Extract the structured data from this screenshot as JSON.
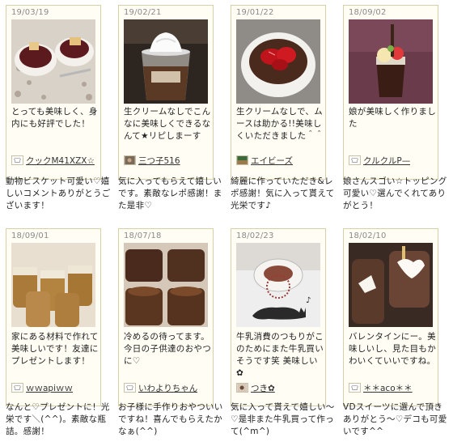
{
  "cards": [
    {
      "date": "19/03/19",
      "comment": "とっても美味しく、身内にも好評でした！",
      "user": "クックM41XZX☆",
      "avatar_icon": "chef-hat-icon",
      "reply": "動物ビスケット可愛い♡嬉しいコメントありがとうございます！"
    },
    {
      "date": "19/02/21",
      "comment": "生クリームなしでこんなに美味しくできるなんて★リピしまーす",
      "user": "三つ子516",
      "avatar_icon": "photo-avatar-icon",
      "reply": "気に入ってもらえて嬉しいです。素敵なレポ感謝！また是非♡"
    },
    {
      "date": "19/01/22",
      "comment": "生クリームなしで、ムースは助かる!!美味しくいただきました＾＾",
      "user": "エイビーズ",
      "avatar_icon": "photo-avatar-icon",
      "reply": "綺麗に作っていただき&レポ感謝！気に入って貰えて光栄です♪"
    },
    {
      "date": "18/09/02",
      "comment": "娘が美味しく作りました",
      "user": "クルクルP—",
      "avatar_icon": "chef-hat-icon",
      "reply": "娘さんスゴい☆トッピング可愛い♡選んでくれてありがとう！"
    },
    {
      "date": "18/09/01",
      "comment": "家にある材料で作れて美味しいです！友達にプレゼントします！",
      "user": "ｗｗapiｗｗ",
      "avatar_icon": "chef-hat-icon",
      "reply": "なんと♡プレゼントに！光栄です＼(^^)。素敵な瓶詰。感謝！"
    },
    {
      "date": "18/07/18",
      "comment": "冷めるの待ってます。今日の子供達のおやつに♡",
      "user": "いわよりちゃん",
      "avatar_icon": "chef-hat-icon",
      "reply": "お子様に手作りおやついいですね！喜んでもらえたかなぁ(^^)"
    },
    {
      "date": "18/02/23",
      "comment": "牛乳消費のつもりがこのためにまた牛乳買いそうです笑 美味しい✿",
      "user": "つき✿",
      "avatar_icon": "photo-avatar-icon",
      "reply": "気に入って貰えて嬉しい〜♡是非また牛乳買って作って(^m^)"
    },
    {
      "date": "18/02/10",
      "comment": "バレンタインにー。美味しいし、見た目もかわいくていいですね。",
      "user": "＊＊aco＊＊",
      "avatar_icon": "chef-hat-icon",
      "reply": "VDスイーツに選んで頂きありがとう〜♡デコも可愛いです^^"
    }
  ],
  "photos": [
    {
      "icon": "mousse-with-animal-biscuits-photo"
    },
    {
      "icon": "mousse-cup-with-whipped-cream-photo"
    },
    {
      "icon": "mousse-with-strawberries-photo"
    },
    {
      "icon": "mousse-with-fruit-topping-photo"
    },
    {
      "icon": "mousse-in-glass-jars-photo"
    },
    {
      "icon": "mousse-in-glass-cups-photo"
    },
    {
      "icon": "mousse-glass-with-cat-design-photo"
    },
    {
      "icon": "valentine-mousse-cups-photo"
    }
  ]
}
